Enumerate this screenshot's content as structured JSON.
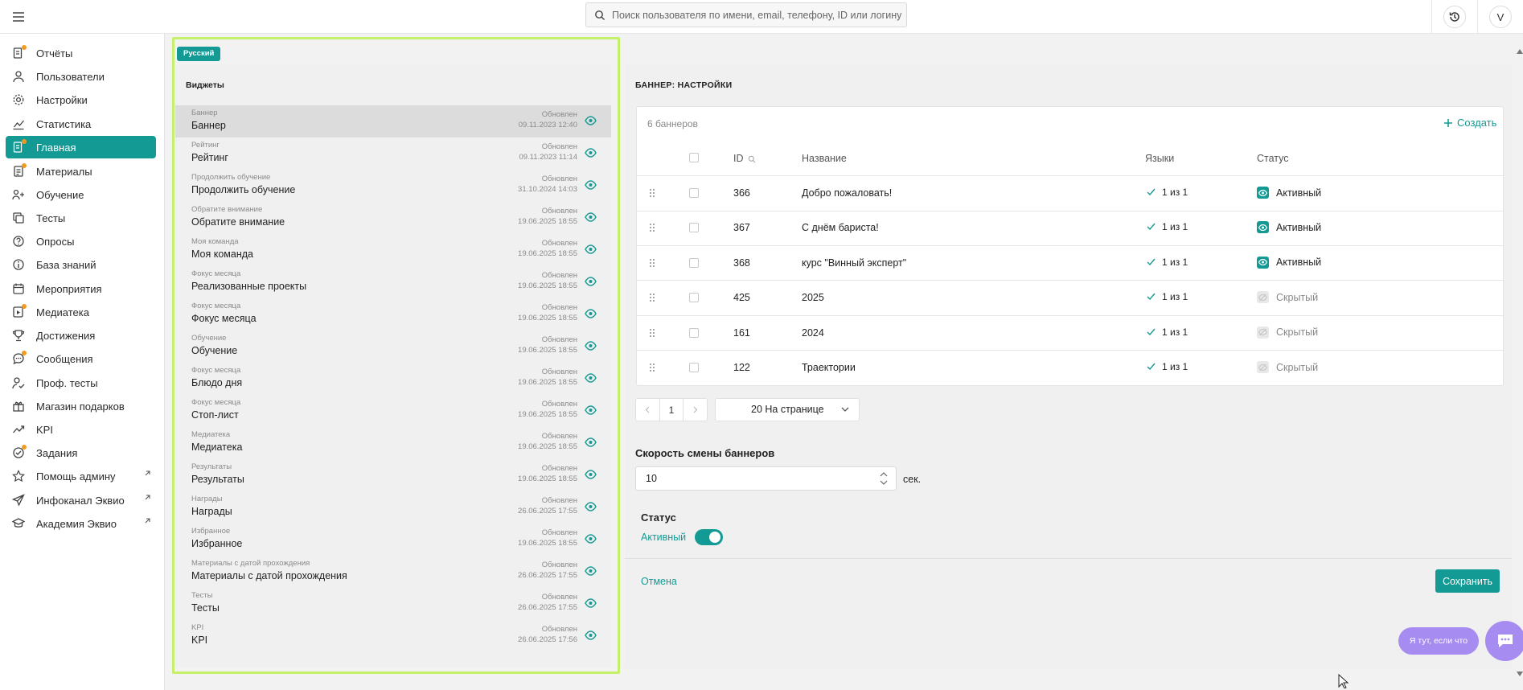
{
  "topbar": {
    "search_placeholder": "Поиск пользователя по имени, email, телефону, ID или логину",
    "avatar_letter": "V"
  },
  "sidebar": {
    "items": [
      {
        "label": "Отчёты",
        "icon": "reports-icon"
      },
      {
        "label": "Пользователи",
        "icon": "users-icon"
      },
      {
        "label": "Настройки",
        "icon": "gear-icon"
      },
      {
        "label": "Статистика",
        "icon": "chart-icon"
      },
      {
        "label": "Главная",
        "icon": "home-icon",
        "active": true
      },
      {
        "label": "Материалы",
        "icon": "materials-icon"
      },
      {
        "label": "Обучение",
        "icon": "learning-icon"
      },
      {
        "label": "Тесты",
        "icon": "tests-icon"
      },
      {
        "label": "Опросы",
        "icon": "polls-icon"
      },
      {
        "label": "База знаний",
        "icon": "info-icon"
      },
      {
        "label": "Мероприятия",
        "icon": "calendar-icon"
      },
      {
        "label": "Медиатека",
        "icon": "media-icon"
      },
      {
        "label": "Достижения",
        "icon": "trophy-icon"
      },
      {
        "label": "Сообщения",
        "icon": "messages-icon"
      },
      {
        "label": "Проф. тесты",
        "icon": "prof-tests-icon"
      },
      {
        "label": "Магазин подарков",
        "icon": "gift-icon"
      },
      {
        "label": "KPI",
        "icon": "trend-icon"
      },
      {
        "label": "Задания",
        "icon": "tasks-icon"
      },
      {
        "label": "Помощь админу",
        "icon": "star-icon",
        "external": true
      },
      {
        "label": "Инфоканал Эквио",
        "icon": "send-icon",
        "external": true
      },
      {
        "label": "Академия Эквио",
        "icon": "academy-icon",
        "external": true
      }
    ]
  },
  "widgets": {
    "lang_badge": "Русский",
    "title": "Виджеты",
    "updated_label": "Обновлен",
    "items": [
      {
        "category": "Баннер",
        "name": "Баннер",
        "date": "09.11.2023 12:40",
        "selected": true
      },
      {
        "category": "Рейтинг",
        "name": "Рейтинг",
        "date": "09.11.2023 11:14"
      },
      {
        "category": "Продолжить обучение",
        "name": "Продолжить обучение",
        "date": "31.10.2024 14:03"
      },
      {
        "category": "Обратите внимание",
        "name": "Обратите внимание",
        "date": "19.06.2025 18:55"
      },
      {
        "category": "Моя команда",
        "name": "Моя команда",
        "date": "19.06.2025 18:55"
      },
      {
        "category": "Фокус месяца",
        "name": "Реализованные проекты",
        "date": "19.06.2025 18:55"
      },
      {
        "category": "Фокус месяца",
        "name": "Фокус месяца",
        "date": "19.06.2025 18:55"
      },
      {
        "category": "Обучение",
        "name": "Обучение",
        "date": "19.06.2025 18:55"
      },
      {
        "category": "Фокус месяца",
        "name": "Блюдо дня",
        "date": "19.06.2025 18:55"
      },
      {
        "category": "Фокус месяца",
        "name": "Стоп-лист",
        "date": "19.06.2025 18:55"
      },
      {
        "category": "Медиатека",
        "name": "Медиатека",
        "date": "19.06.2025 18:55"
      },
      {
        "category": "Результаты",
        "name": "Результаты",
        "date": "19.06.2025 18:55"
      },
      {
        "category": "Награды",
        "name": "Награды",
        "date": "26.06.2025 17:55"
      },
      {
        "category": "Избранное",
        "name": "Избранное",
        "date": "19.06.2025 18:55"
      },
      {
        "category": "Материалы с датой прохождения",
        "name": "Материалы с датой прохождения",
        "date": "26.06.2025 17:55"
      },
      {
        "category": "Тесты",
        "name": "Тесты",
        "date": "26.06.2025 17:55"
      },
      {
        "category": "KPI",
        "name": "KPI",
        "date": "26.06.2025 17:56"
      }
    ]
  },
  "banner": {
    "title": "БАННЕР: НАСТРОЙКИ",
    "count": "6 баннеров",
    "create_label": "Создать",
    "columns": {
      "id": "ID",
      "name": "Название",
      "langs": "Языки",
      "status": "Статус"
    },
    "rows": [
      {
        "id": "366",
        "name": "Добро пожаловать!",
        "langs": "1 из 1",
        "status": "Активный",
        "active": true
      },
      {
        "id": "367",
        "name": "С днём бариста!",
        "langs": "1 из 1",
        "status": "Активный",
        "active": true
      },
      {
        "id": "368",
        "name": "курс \"Винный эксперт\"",
        "langs": "1 из 1",
        "status": "Активный",
        "active": true
      },
      {
        "id": "425",
        "name": "2025",
        "langs": "1 из 1",
        "status": "Скрытый",
        "active": false
      },
      {
        "id": "161",
        "name": "2024",
        "langs": "1 из 1",
        "status": "Скрытый",
        "active": false
      },
      {
        "id": "122",
        "name": "Траектории",
        "langs": "1 из 1",
        "status": "Скрытый",
        "active": false
      }
    ],
    "pagination": {
      "page": "1",
      "per_page": "20 На странице"
    },
    "speed_label": "Скорость смены баннеров",
    "speed_value": "10",
    "speed_unit": "сек.",
    "status_label": "Статус",
    "status_value": "Активный",
    "cancel_label": "Отмена",
    "save_label": "Сохранить"
  },
  "help": {
    "bubble": "Я тут, если что"
  },
  "colors": {
    "accent": "#139a94",
    "highlight_frame": "#c6f06a",
    "help": "#a68cf0",
    "notify_dot": "#f29a20"
  }
}
